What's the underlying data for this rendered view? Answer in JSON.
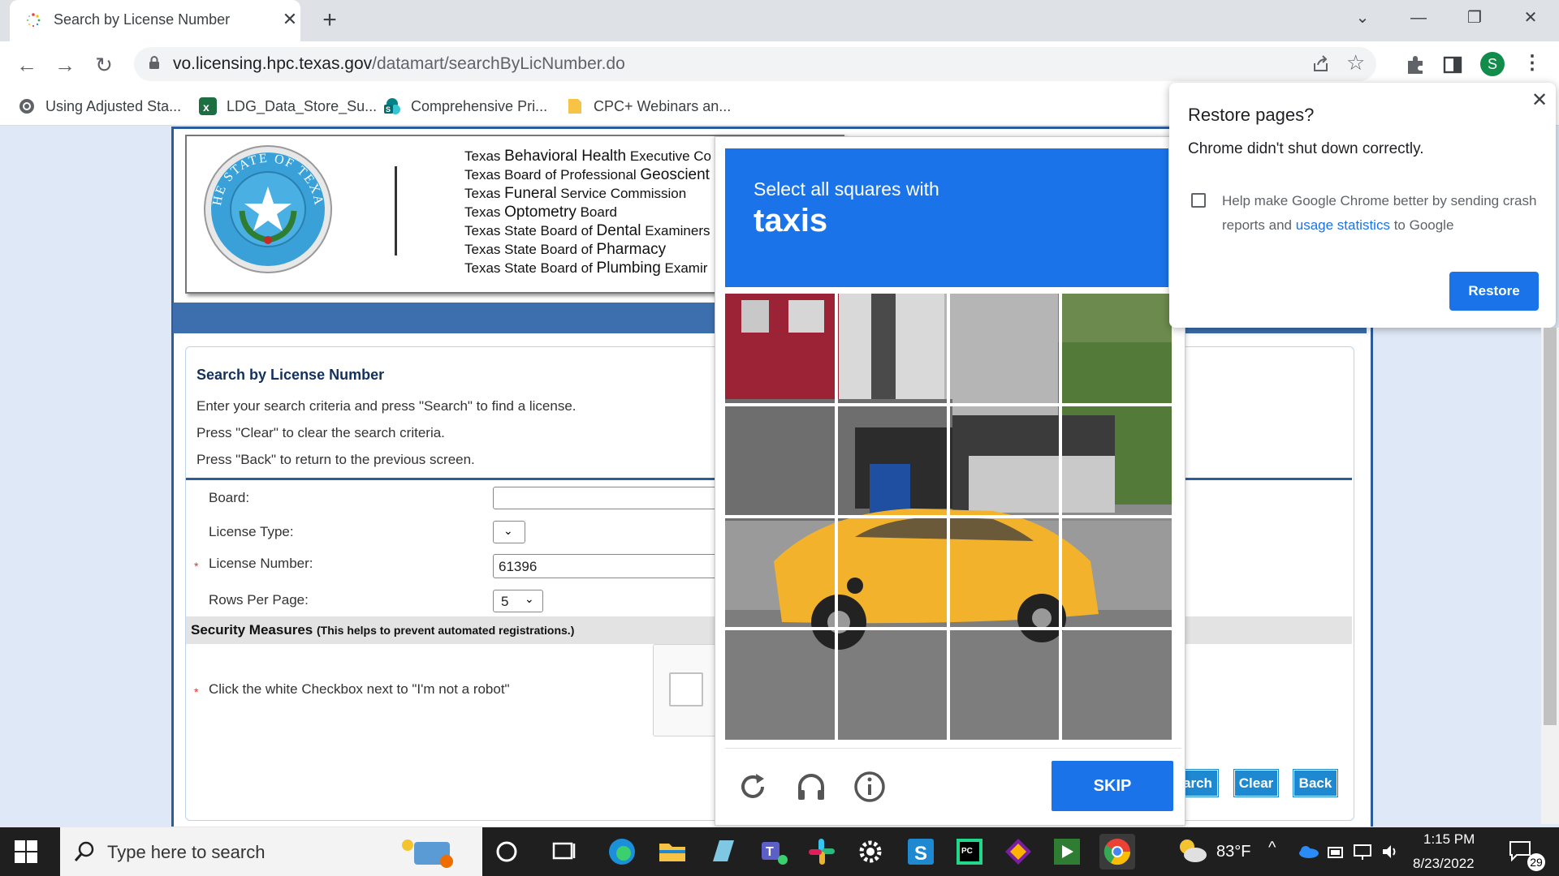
{
  "browser": {
    "tab_title": "Search by License Number",
    "tab_close": "✕",
    "new_tab": "+",
    "window_controls": [
      "⌄",
      "—",
      "❐",
      "✕"
    ],
    "nav": {
      "back": "←",
      "forward": "→",
      "reload": "↻"
    },
    "url_host": "vo.licensing.hpc.texas.gov",
    "url_path": "/datamart/searchByLicNumber.do",
    "profile_initial": "S",
    "bookmarks": [
      {
        "label": "Using Adjusted Sta...",
        "icon": "globe-icon",
        "color": "#5f6368"
      },
      {
        "label": "LDG_Data_Store_Su...",
        "icon": "excel-icon",
        "color": "#1d6f42"
      },
      {
        "label": "Comprehensive Pri...",
        "icon": "sharepoint-icon",
        "color": "#038387"
      },
      {
        "label": "CPC+ Webinars an...",
        "icon": "folder-icon",
        "color": "#f6c344"
      }
    ]
  },
  "page": {
    "boards": [
      {
        "pre": "Texas ",
        "big": "Behavioral Health",
        "post": " Executive Co"
      },
      {
        "pre": "Texas Board of Professional ",
        "big": "Geoscient",
        "post": ""
      },
      {
        "pre": "Texas ",
        "big": "Funeral",
        "post": " Service Commission"
      },
      {
        "pre": "Texas ",
        "big": "Optometry",
        "post": " Board"
      },
      {
        "pre": "Texas State Board of ",
        "big": "Dental",
        "post": " Examiners"
      },
      {
        "pre": "Texas State Board of ",
        "big": "Pharmacy",
        "post": ""
      },
      {
        "pre": "Texas State Board of ",
        "big": "Plumbing",
        "post": " Examir"
      }
    ],
    "seal_text": "THE STATE OF TEXAS",
    "form_title": "Search by License Number",
    "instructions": [
      "Enter your search criteria and press \"Search\" to find a license.",
      "Press \"Clear\" to clear the search criteria.",
      "Press \"Back\" to return to the previous screen."
    ],
    "fields": {
      "board_label": "Board:",
      "board_value": "",
      "license_type_label": "License Type:",
      "license_number_label": "License Number:",
      "license_number_value": "61396",
      "rows_label": "Rows Per Page:",
      "rows_value": "5"
    },
    "required_mark": "*",
    "security_title": "Security Measures",
    "security_note": "(This helps to prevent automated registrations.)",
    "robot_instruction": "Click the white Checkbox next to \"I'm not a robot\"",
    "buttons": {
      "search": "arch",
      "clear": "Clear",
      "back": "Back"
    }
  },
  "captcha": {
    "prompt": "Select all squares with",
    "target": "taxis",
    "skip": "SKIP",
    "icons": [
      "reload-icon",
      "audio-icon",
      "info-icon"
    ]
  },
  "restore_popup": {
    "title": "Restore pages?",
    "message": "Chrome didn't shut down correctly.",
    "help_pre": "Help make Google Chrome better by sending crash reports and ",
    "help_link": "usage statistics",
    "help_post": " to Google",
    "button": "Restore",
    "close": "✕"
  },
  "taskbar": {
    "search_placeholder": "Type here to search",
    "temperature": "83°F",
    "time": "1:15 PM",
    "date": "8/23/2022",
    "notification_count": "29"
  },
  "colors": {
    "chrome_blue": "#1a73e8",
    "page_blue": "#2d5c9a",
    "button_blue": "#1e88d0"
  }
}
